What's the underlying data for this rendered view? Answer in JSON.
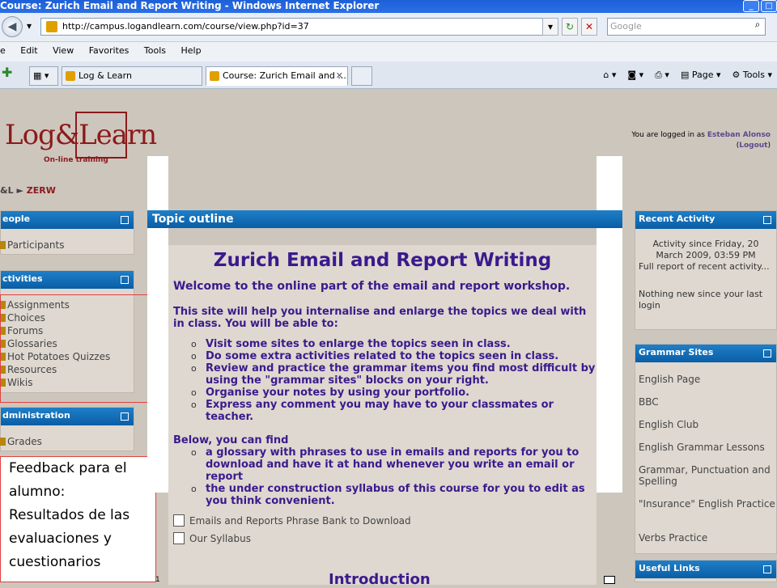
{
  "window": {
    "title": "Course: Zurich Email and Report Writing - Windows Internet Explorer"
  },
  "address": {
    "url": "http://campus.logandlearn.com/course/view.php?id=37",
    "search_placeholder": "Google"
  },
  "menu": [
    "e",
    "Edit",
    "View",
    "Favorites",
    "Tools",
    "Help"
  ],
  "tabs": [
    {
      "label": "Log & Learn"
    },
    {
      "label": "Course: Zurich Email and ..."
    }
  ],
  "toolbar": {
    "page": "Page",
    "tools": "Tools"
  },
  "header": {
    "logo": "Log&Learn",
    "logo_sub": "On-line training",
    "logged_prefix": "You are logged in as",
    "user": "Esteban Alonso",
    "logout": "Logout"
  },
  "breadcrumb": {
    "home": "&L",
    "sep": "►",
    "current": "ZERW"
  },
  "left": {
    "people": {
      "title": "eople",
      "items": [
        "Participants"
      ]
    },
    "activities": {
      "title": "ctivities",
      "items": [
        "Assignments",
        "Choices",
        "Forums",
        "Glossaries",
        "Hot Potatoes Quizzes",
        "Resources",
        "Wikis"
      ]
    },
    "admin": {
      "title": "dministration",
      "items": [
        "Grades"
      ]
    }
  },
  "feedback": {
    "lines": [
      "Feedback  para el",
      "alumno:",
      "Resultados de las",
      "evaluaciones y",
      "cuestionarios"
    ]
  },
  "main": {
    "header": "Topic outline",
    "title": "Zurich Email and Report Writing",
    "welcome": "Welcome to the online part of the email and report workshop.",
    "intro": "This site will help you internalise and enlarge the topics we deal with in class. You will be able to:",
    "bullets": [
      "Visit some sites to enlarge the topics seen in class.",
      "Do some extra activities related to the topics seen in class.",
      "Review and practice the grammar items you find most difficult by using the \"grammar sites\" blocks on your right.",
      "Organise your notes by using your portfolio.",
      "Express any comment you may have to your classmates or teacher."
    ],
    "below": "Below, you can find",
    "bullets2": [
      "a glossary with phrases to use in emails and reports for you to download and have it at hand whenever you write an email or report",
      "the under construction syllabus of this course for you to edit as you think convenient."
    ],
    "links": [
      "Emails and Reports Phrase Bank to Download",
      "Our Syllabus"
    ],
    "section_num": "1",
    "section_title": "Introduction"
  },
  "right": {
    "recent": {
      "title": "Recent Activity",
      "since": "Activity since Friday, 20 March 2009, 03:59 PM",
      "full": "Full report of recent activity...",
      "nothing": "Nothing new since your last login"
    },
    "grammar": {
      "title": "Grammar Sites",
      "items": [
        "English Page",
        "BBC",
        "English Club",
        "English Grammar Lessons",
        "Grammar, Punctuation and Spelling",
        "\"Insurance\" English Practice",
        "Verbs Practice"
      ]
    },
    "useful": {
      "title": "Useful Links"
    }
  }
}
